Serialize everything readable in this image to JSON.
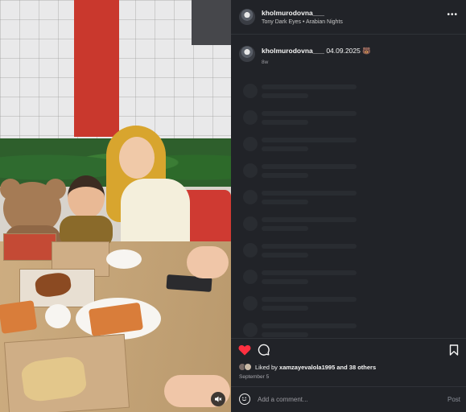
{
  "post": {
    "author": "kholmurodovna___",
    "audio": "Tony Dark Eyes • Arabian Nights",
    "menu_glyph": "•••"
  },
  "caption": {
    "username": "kholmurodovna___",
    "text": "04.09.2025",
    "emoji": "🐻",
    "time": "8w"
  },
  "likes": {
    "prefix": "Liked by",
    "user": "xamzayevalola1995",
    "suffix": "and 38 others"
  },
  "date": "September 5",
  "comment": {
    "placeholder": "Add a comment...",
    "post_label": "Post"
  },
  "colors": {
    "panel_bg": "#212328",
    "like_red": "#ff3040",
    "skeleton": "#292c31"
  },
  "icons": {
    "like": "heart-filled",
    "comment": "speech-bubble",
    "save": "bookmark",
    "emoji": "smiley",
    "audio": "speaker-muted"
  }
}
